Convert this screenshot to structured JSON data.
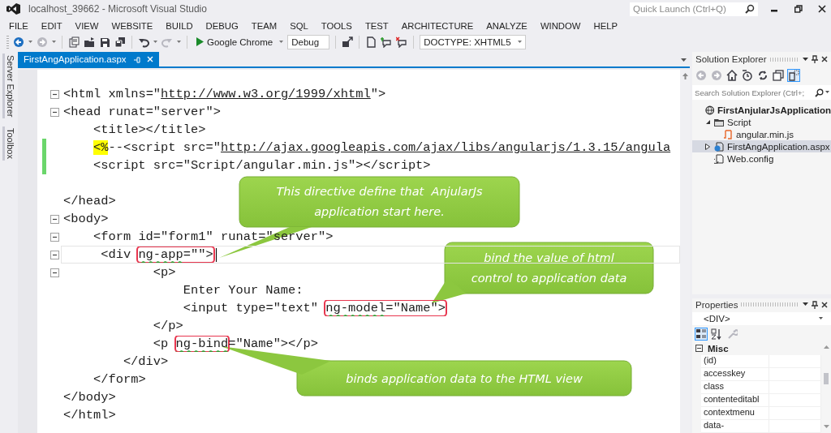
{
  "window": {
    "title": "localhost_39662 - Microsoft Visual Studio",
    "quick_launch": {
      "placeholder": "Quick Launch (Ctrl+Q)"
    }
  },
  "menu": [
    "FILE",
    "EDIT",
    "VIEW",
    "WEBSITE",
    "BUILD",
    "DEBUG",
    "TEAM",
    "SQL",
    "TOOLS",
    "TEST",
    "ARCHITECTURE",
    "ANALYZE",
    "WINDOW",
    "HELP"
  ],
  "toolbar": {
    "buttons": [
      {
        "kind": "back",
        "disabled": false
      },
      {
        "kind": "forward",
        "disabled": true
      },
      {
        "kind": "new",
        "disabled": false
      },
      {
        "kind": "open",
        "disabled": false
      },
      {
        "kind": "save",
        "disabled": false
      },
      {
        "kind": "save-all",
        "disabled": false
      },
      {
        "kind": "undo",
        "disabled": false
      },
      {
        "kind": "redo",
        "disabled": true
      }
    ],
    "run_target": "Google Chrome",
    "configuration": "Debug",
    "tools": [
      {
        "kind": "browse",
        "disabled": false
      },
      {
        "kind": "page",
        "disabled": false
      },
      {
        "kind": "comment",
        "disabled": false
      },
      {
        "kind": "uncomment",
        "disabled": false
      }
    ],
    "doctype": "DOCTYPE: XHTML5"
  },
  "side_tabs": [
    "Server Explorer",
    "Toolbox"
  ],
  "document_tabs": [
    {
      "label": "FirstAngApplication.aspx",
      "selected": true
    }
  ],
  "code": {
    "lines": [
      {
        "fold": true,
        "changed": false,
        "current": false,
        "tokens": [
          {
            "kind": "punct",
            "text": "<"
          },
          {
            "kind": "tag",
            "text": "html"
          },
          {
            "kind": "attr",
            "text": " xmlns"
          },
          {
            "kind": "punct",
            "text": "=\""
          },
          {
            "kind": "link",
            "text": "http://www.w3.org/1999/xhtml"
          },
          {
            "kind": "punct",
            "text": "\">"
          }
        ]
      },
      {
        "fold": true,
        "changed": false,
        "current": false,
        "tokens": [
          {
            "kind": "punct",
            "text": "<"
          },
          {
            "kind": "tag",
            "text": "head"
          },
          {
            "kind": "attr",
            "text": " runat"
          },
          {
            "kind": "punct",
            "text": "=\"server\">"
          }
        ]
      },
      {
        "fold": false,
        "changed": false,
        "current": false,
        "tokens": [
          {
            "kind": "punct",
            "text": "    <"
          },
          {
            "kind": "tag",
            "text": "title"
          },
          {
            "kind": "punct",
            "text": "></"
          },
          {
            "kind": "tag",
            "text": "title"
          },
          {
            "kind": "punct",
            "text": ">"
          }
        ]
      },
      {
        "fold": false,
        "changed": true,
        "current": false,
        "tokens": [
          {
            "kind": "marker",
            "text": "    <%"
          },
          {
            "kind": "comment",
            "text": "--<script src=\""
          },
          {
            "kind": "link",
            "text": "http://ajax.googleapis.com/ajax/libs/angularjs/1.3.15/angula"
          }
        ]
      },
      {
        "fold": false,
        "changed": true,
        "current": false,
        "tokens": [
          {
            "kind": "punct",
            "text": "    <"
          },
          {
            "kind": "tag",
            "text": "script"
          },
          {
            "kind": "attr",
            "text": " src"
          },
          {
            "kind": "punct",
            "text": "=\"Script/angular.min.js\"></"
          },
          {
            "kind": "tag",
            "text": "script"
          },
          {
            "kind": "punct",
            "text": ">"
          }
        ]
      },
      {
        "fold": false,
        "changed": false,
        "current": false
      },
      {
        "fold": false,
        "changed": false,
        "current": false,
        "tokens": [
          {
            "kind": "punct",
            "text": "</"
          },
          {
            "kind": "tag",
            "text": "head"
          },
          {
            "kind": "punct",
            "text": ">"
          }
        ]
      },
      {
        "fold": true,
        "changed": false,
        "current": false,
        "tokens": [
          {
            "kind": "punct",
            "text": "<"
          },
          {
            "kind": "tag",
            "text": "body"
          },
          {
            "kind": "punct",
            "text": ">"
          }
        ]
      },
      {
        "fold": true,
        "changed": false,
        "current": false,
        "tokens": [
          {
            "kind": "punct",
            "text": "    <"
          },
          {
            "kind": "tag",
            "text": "form"
          },
          {
            "kind": "attr",
            "text": " id"
          },
          {
            "kind": "punct",
            "text": "=\"form1\""
          },
          {
            "kind": "attr",
            "text": " runat"
          },
          {
            "kind": "punct",
            "text": "=\"server\">"
          }
        ]
      },
      {
        "fold": true,
        "changed": false,
        "current": true,
        "tokens": [
          {
            "kind": "punct",
            "text": "     <"
          },
          {
            "kind": "tag",
            "text": "div "
          },
          {
            "kind": "boxed",
            "tokens": [
              {
                "kind": "directive",
                "text": "ng-app"
              },
              {
                "kind": "punct",
                "text": "=\"\">"
              }
            ]
          }
        ]
      },
      {
        "fold": true,
        "changed": false,
        "current": false,
        "tokens": [
          {
            "kind": "punct",
            "text": "            <"
          },
          {
            "kind": "tag",
            "text": "p"
          },
          {
            "kind": "punct",
            "text": ">"
          }
        ]
      },
      {
        "fold": false,
        "changed": false,
        "current": false,
        "tokens": [
          {
            "kind": "text",
            "text": "                Enter Your Name:"
          }
        ]
      },
      {
        "fold": false,
        "changed": false,
        "current": false,
        "tokens": [
          {
            "kind": "punct",
            "text": "                <"
          },
          {
            "kind": "tag",
            "text": "input"
          },
          {
            "kind": "attr",
            "text": " type"
          },
          {
            "kind": "punct",
            "text": "=\"text\" "
          },
          {
            "kind": "boxed",
            "tokens": [
              {
                "kind": "directive",
                "text": "ng-model"
              },
              {
                "kind": "punct",
                "text": "=\"Name\">"
              }
            ]
          }
        ]
      },
      {
        "fold": false,
        "changed": false,
        "current": false,
        "tokens": [
          {
            "kind": "punct",
            "text": "            </"
          },
          {
            "kind": "tag",
            "text": "p"
          },
          {
            "kind": "punct",
            "text": ">"
          }
        ]
      },
      {
        "fold": false,
        "changed": false,
        "current": false,
        "tokens": [
          {
            "kind": "punct",
            "text": "            <"
          },
          {
            "kind": "tag",
            "text": "p "
          },
          {
            "kind": "boxed",
            "tokens": [
              {
                "kind": "directive",
                "text": "ng-bind"
              }
            ]
          },
          {
            "kind": "punct",
            "text": "=\"Name\"></"
          },
          {
            "kind": "tag",
            "text": "p"
          },
          {
            "kind": "punct",
            "text": ">"
          }
        ]
      },
      {
        "fold": false,
        "changed": false,
        "current": false,
        "tokens": [
          {
            "kind": "punct",
            "text": "        </"
          },
          {
            "kind": "tag",
            "text": "div"
          },
          {
            "kind": "punct",
            "text": ">"
          }
        ]
      },
      {
        "fold": false,
        "changed": false,
        "current": false,
        "tokens": [
          {
            "kind": "punct",
            "text": "    </"
          },
          {
            "kind": "tag",
            "text": "form"
          },
          {
            "kind": "punct",
            "text": ">"
          }
        ]
      },
      {
        "fold": false,
        "changed": false,
        "current": false,
        "tokens": [
          {
            "kind": "punct",
            "text": "</"
          },
          {
            "kind": "tag",
            "text": "body"
          },
          {
            "kind": "punct",
            "text": ">"
          }
        ]
      },
      {
        "fold": false,
        "changed": false,
        "current": false,
        "tokens": [
          {
            "kind": "punct",
            "text": "</"
          },
          {
            "kind": "tag",
            "text": "html"
          },
          {
            "kind": "punct",
            "text": ">"
          }
        ]
      }
    ]
  },
  "callouts": [
    {
      "text": "This directive define that  AnjularJs\napplication start here."
    },
    {
      "text": "bind the value of html\ncontrol to application data"
    },
    {
      "text": "binds application data to the HTML view"
    }
  ],
  "solution_explorer": {
    "title": "Solution Explorer",
    "buttons": [
      {
        "kind": "back",
        "disabled": true,
        "selected": false
      },
      {
        "kind": "forward",
        "disabled": true,
        "selected": false
      },
      {
        "kind": "home",
        "disabled": false,
        "selected": false
      },
      {
        "kind": "history",
        "disabled": false,
        "selected": false
      },
      {
        "kind": "sync",
        "disabled": false,
        "selected": false
      },
      {
        "kind": "collapse",
        "disabled": false,
        "selected": false
      },
      {
        "kind": "show-all",
        "disabled": false,
        "selected": true
      }
    ],
    "search": {
      "placeholder": "Search Solution Explorer (Ctrl+;"
    },
    "tree": [
      {
        "label": "FirstAnjularJsApplication",
        "kind": "project",
        "selected": false,
        "children": [
          {
            "label": "Script",
            "kind": "folder",
            "expanded": true,
            "selected": false,
            "children": [
              {
                "label": "angular.min.js",
                "kind": "js",
                "selected": false
              }
            ]
          },
          {
            "label": "FirstAngApplication.aspx",
            "kind": "aspx",
            "expanded": false,
            "selected": true
          },
          {
            "label": "Web.config",
            "kind": "config",
            "selected": false
          }
        ]
      }
    ]
  },
  "properties": {
    "title": "Properties",
    "object": "<DIV>",
    "buttons": [
      {
        "kind": "categorized",
        "disabled": false,
        "selected": true
      },
      {
        "kind": "alphabetical",
        "disabled": false,
        "selected": false
      },
      {
        "kind": "pages",
        "disabled": true,
        "selected": false
      }
    ],
    "category": {
      "label": "Misc",
      "expanded": true
    },
    "rows": [
      "(id)",
      "accesskey",
      "class",
      "contenteditabl",
      "contextmenu",
      "data-"
    ]
  }
}
